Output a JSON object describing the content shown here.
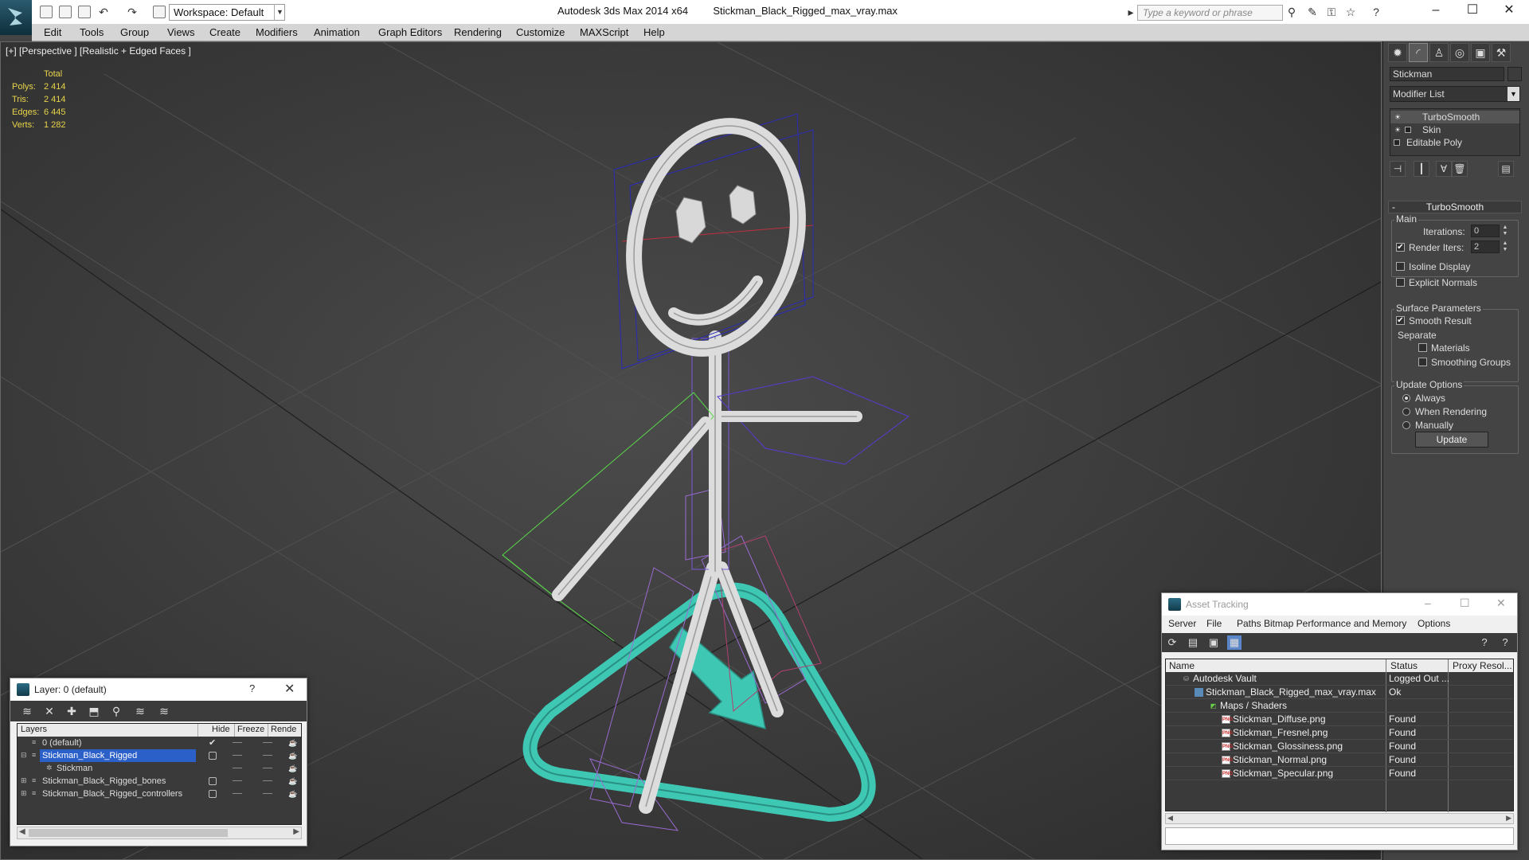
{
  "titlebar": {
    "app_title": "Autodesk 3ds Max  2014 x64",
    "file_title": "Stickman_Black_Rigged_max_vray.max",
    "workspace": "Workspace: Default",
    "search_placeholder": "Type a keyword or phrase"
  },
  "menu": [
    "Edit",
    "Tools",
    "Group",
    "Views",
    "Create",
    "Modifiers",
    "Animation",
    "Graph Editors",
    "Rendering",
    "Customize",
    "MAXScript",
    "Help"
  ],
  "viewport": {
    "label": "[+] [Perspective ] [Realistic + Edged Faces ]",
    "stats": {
      "header": "Total",
      "polys_label": "Polys:",
      "polys": "2 414",
      "tris_label": "Tris:",
      "tris": "2 414",
      "edges_label": "Edges:",
      "edges": "6 445",
      "verts_label": "Verts:",
      "verts": "1 282"
    }
  },
  "command_panel": {
    "object_name": "Stickman",
    "modifier_list": "Modifier List",
    "stack": [
      "TurboSmooth",
      "Skin",
      "Editable Poly"
    ],
    "rollout_title": "TurboSmooth",
    "main_label": "Main",
    "iterations_label": "Iterations:",
    "iterations_value": "0",
    "render_iters_label": "Render Iters:",
    "render_iters_value": "2",
    "render_iters_checked": "✔",
    "isoline_label": "Isoline Display",
    "explicit_normals_label": "Explicit Normals",
    "surface_params_label": "Surface Parameters",
    "smooth_result_label": "Smooth Result",
    "smooth_result_checked": "✔",
    "separate_label": "Separate",
    "materials_label": "Materials",
    "smoothing_groups_label": "Smoothing Groups",
    "update_options_label": "Update Options",
    "always_label": "Always",
    "when_rendering_label": "When Rendering",
    "manually_label": "Manually",
    "update_button": "Update"
  },
  "layer_dialog": {
    "title": "Layer: 0 (default)",
    "help": "?",
    "columns": [
      "Layers",
      "Hide",
      "Freeze",
      "Rende"
    ],
    "rows": [
      "0 (default)",
      "Stickman_Black_Rigged",
      "Stickman",
      "Stickman_Black_Rigged_bones",
      "Stickman_Black_Rigged_controllers"
    ],
    "default_checkmark": "✔"
  },
  "asset_tracking": {
    "title": "Asset Tracking",
    "menu": [
      "Server",
      "File",
      "Paths",
      "Bitmap Performance and Memory",
      "Options"
    ],
    "columns": [
      "Name",
      "Status",
      "Proxy Resol..."
    ],
    "rows": [
      {
        "name": "Autodesk Vault",
        "status": "Logged Out ..."
      },
      {
        "name": "Stickman_Black_Rigged_max_vray.max",
        "status": "Ok"
      },
      {
        "name": "Maps / Shaders",
        "status": ""
      },
      {
        "name": "Stickman_Diffuse.png",
        "status": "Found"
      },
      {
        "name": "Stickman_Fresnel.png",
        "status": "Found"
      },
      {
        "name": "Stickman_Glossiness.png",
        "status": "Found"
      },
      {
        "name": "Stickman_Normal.png",
        "status": "Found"
      },
      {
        "name": "Stickman_Specular.png",
        "status": "Found"
      }
    ],
    "png_badge": "PNG"
  },
  "colors": {
    "stats_text": "#e8d44a",
    "controller_cyan": "#3ec8b4",
    "selection_blue": "#2b60c8",
    "bone_outline_blue": "#2a2ab8",
    "arm_helper_green": "#5ad84a"
  }
}
